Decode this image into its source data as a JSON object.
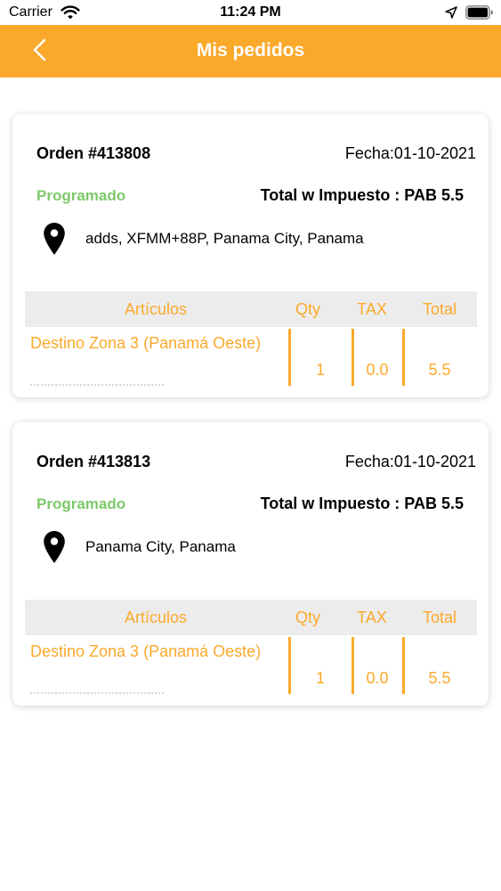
{
  "status_bar": {
    "carrier": "Carrier",
    "time": "11:24 PM"
  },
  "nav": {
    "title": "Mis pedidos",
    "back_icon": "chevron-left-icon"
  },
  "colors": {
    "accent": "#fba92b",
    "status_green": "#7dc96b",
    "table_header_bg": "#ececec"
  },
  "table_headers": {
    "articulos": "Artículos",
    "qty": "Qty",
    "tax": "TAX",
    "total": "Total"
  },
  "orders": [
    {
      "number": "Orden #413808",
      "date": "Fecha:01-10-2021",
      "status": "Programado",
      "total": "Total w Impuesto : PAB 5.5",
      "address": "adds, XFMM+88P, Panama City, Panama",
      "items": [
        {
          "name": "Destino Zona 3 (Panamá Oeste)",
          "qty": "1",
          "tax": "0.0",
          "total": "5.5"
        }
      ]
    },
    {
      "number": "Orden #413813",
      "date": "Fecha:01-10-2021",
      "status": "Programado",
      "total": "Total w Impuesto : PAB 5.5",
      "address": "Panama City, Panama",
      "items": [
        {
          "name": "Destino Zona 3 (Panamá Oeste)",
          "qty": "1",
          "tax": "0.0",
          "total": "5.5"
        }
      ]
    }
  ]
}
